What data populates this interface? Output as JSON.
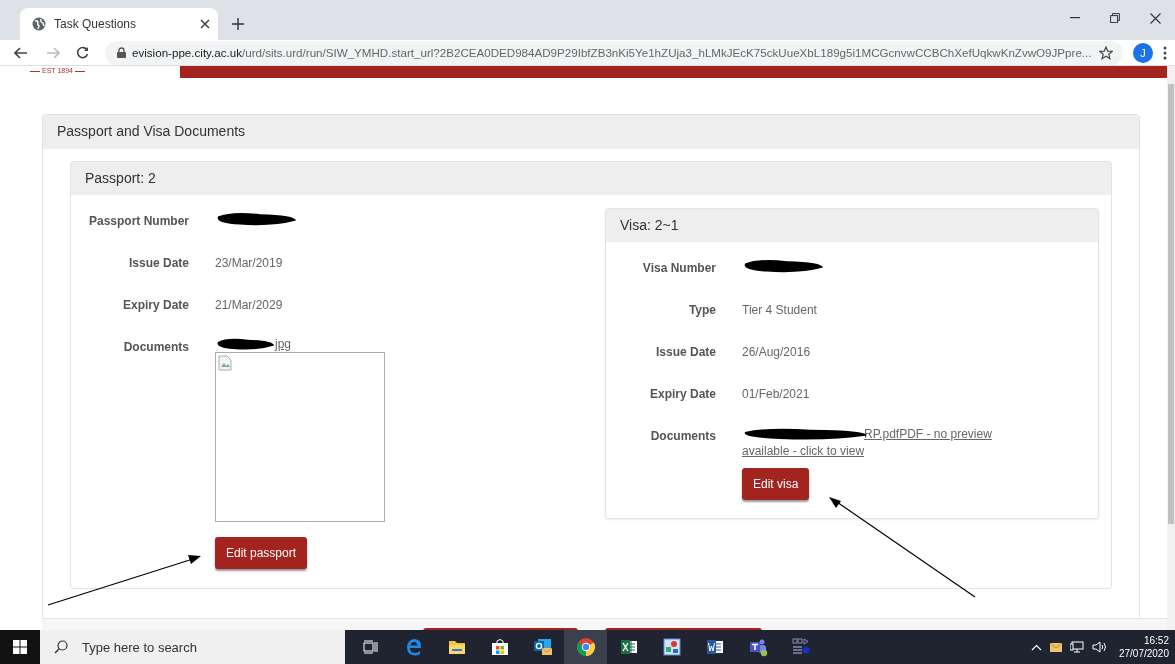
{
  "browser": {
    "tab": {
      "title": "Task Questions",
      "selected": true
    },
    "url": {
      "domain": "evision-ppe.city.ac.uk",
      "path": "/urd/sits.urd/run/SIW_YMHD.start_url?2B2CEA0DED984AD9P29IbfZB3nKi5Ye1hZUja3_hLMkJEcK75ckUueXbL189g5i1MCGcnvwCCBChXefUqkwKnZvwO9JPpre..."
    },
    "profile_initial": "J"
  },
  "page": {
    "logo_text": "EST 1894",
    "section_title": "Passport and Visa Documents",
    "passport": {
      "title": "Passport: 2",
      "fields": [
        {
          "label": "Passport Number",
          "kind": "redacted"
        },
        {
          "label": "Issue Date",
          "kind": "text",
          "value": "23/Mar/2019"
        },
        {
          "label": "Expiry Date",
          "kind": "text",
          "value": "21/Mar/2029"
        },
        {
          "label": "Documents",
          "kind": "image",
          "value": "jpg"
        }
      ],
      "button": "Edit passport"
    },
    "visa": {
      "title": "Visa: 2~1",
      "fields": [
        {
          "label": "Visa Number",
          "kind": "redacted"
        },
        {
          "label": "Type",
          "kind": "text",
          "value": "Tier 4 Student"
        },
        {
          "label": "Issue Date",
          "kind": "text",
          "value": "26/Aug/2016"
        },
        {
          "label": "Expiry Date",
          "kind": "text",
          "value": "01/Feb/2021"
        },
        {
          "label": "Documents",
          "kind": "pdf",
          "value": "RP.pdfPDF - no preview available - click to view"
        }
      ],
      "button": "Edit visa"
    }
  },
  "taskbar": {
    "search": {
      "placeholder": "Type here to search"
    },
    "time": "16:52",
    "date": "27/07/2020"
  }
}
